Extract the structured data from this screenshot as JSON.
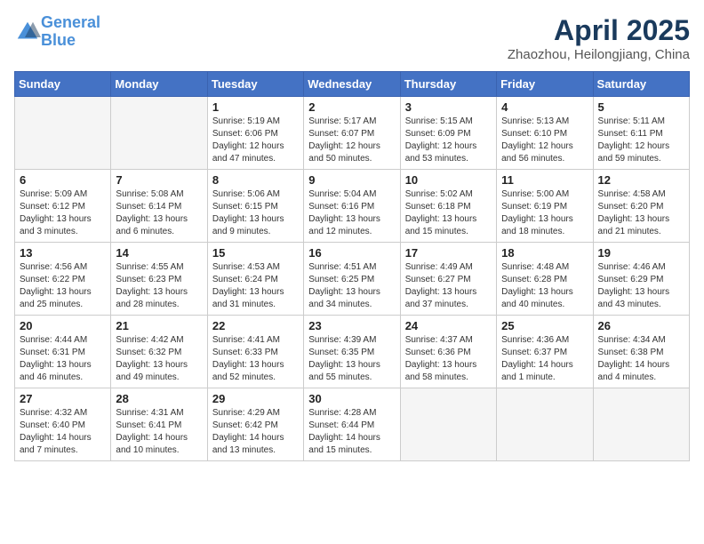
{
  "header": {
    "logo_line1": "General",
    "logo_line2": "Blue",
    "month": "April 2025",
    "location": "Zhaozhou, Heilongjiang, China"
  },
  "weekdays": [
    "Sunday",
    "Monday",
    "Tuesday",
    "Wednesday",
    "Thursday",
    "Friday",
    "Saturday"
  ],
  "weeks": [
    [
      {
        "day": "",
        "info": ""
      },
      {
        "day": "",
        "info": ""
      },
      {
        "day": "1",
        "info": "Sunrise: 5:19 AM\nSunset: 6:06 PM\nDaylight: 12 hours\nand 47 minutes."
      },
      {
        "day": "2",
        "info": "Sunrise: 5:17 AM\nSunset: 6:07 PM\nDaylight: 12 hours\nand 50 minutes."
      },
      {
        "day": "3",
        "info": "Sunrise: 5:15 AM\nSunset: 6:09 PM\nDaylight: 12 hours\nand 53 minutes."
      },
      {
        "day": "4",
        "info": "Sunrise: 5:13 AM\nSunset: 6:10 PM\nDaylight: 12 hours\nand 56 minutes."
      },
      {
        "day": "5",
        "info": "Sunrise: 5:11 AM\nSunset: 6:11 PM\nDaylight: 12 hours\nand 59 minutes."
      }
    ],
    [
      {
        "day": "6",
        "info": "Sunrise: 5:09 AM\nSunset: 6:12 PM\nDaylight: 13 hours\nand 3 minutes."
      },
      {
        "day": "7",
        "info": "Sunrise: 5:08 AM\nSunset: 6:14 PM\nDaylight: 13 hours\nand 6 minutes."
      },
      {
        "day": "8",
        "info": "Sunrise: 5:06 AM\nSunset: 6:15 PM\nDaylight: 13 hours\nand 9 minutes."
      },
      {
        "day": "9",
        "info": "Sunrise: 5:04 AM\nSunset: 6:16 PM\nDaylight: 13 hours\nand 12 minutes."
      },
      {
        "day": "10",
        "info": "Sunrise: 5:02 AM\nSunset: 6:18 PM\nDaylight: 13 hours\nand 15 minutes."
      },
      {
        "day": "11",
        "info": "Sunrise: 5:00 AM\nSunset: 6:19 PM\nDaylight: 13 hours\nand 18 minutes."
      },
      {
        "day": "12",
        "info": "Sunrise: 4:58 AM\nSunset: 6:20 PM\nDaylight: 13 hours\nand 21 minutes."
      }
    ],
    [
      {
        "day": "13",
        "info": "Sunrise: 4:56 AM\nSunset: 6:22 PM\nDaylight: 13 hours\nand 25 minutes."
      },
      {
        "day": "14",
        "info": "Sunrise: 4:55 AM\nSunset: 6:23 PM\nDaylight: 13 hours\nand 28 minutes."
      },
      {
        "day": "15",
        "info": "Sunrise: 4:53 AM\nSunset: 6:24 PM\nDaylight: 13 hours\nand 31 minutes."
      },
      {
        "day": "16",
        "info": "Sunrise: 4:51 AM\nSunset: 6:25 PM\nDaylight: 13 hours\nand 34 minutes."
      },
      {
        "day": "17",
        "info": "Sunrise: 4:49 AM\nSunset: 6:27 PM\nDaylight: 13 hours\nand 37 minutes."
      },
      {
        "day": "18",
        "info": "Sunrise: 4:48 AM\nSunset: 6:28 PM\nDaylight: 13 hours\nand 40 minutes."
      },
      {
        "day": "19",
        "info": "Sunrise: 4:46 AM\nSunset: 6:29 PM\nDaylight: 13 hours\nand 43 minutes."
      }
    ],
    [
      {
        "day": "20",
        "info": "Sunrise: 4:44 AM\nSunset: 6:31 PM\nDaylight: 13 hours\nand 46 minutes."
      },
      {
        "day": "21",
        "info": "Sunrise: 4:42 AM\nSunset: 6:32 PM\nDaylight: 13 hours\nand 49 minutes."
      },
      {
        "day": "22",
        "info": "Sunrise: 4:41 AM\nSunset: 6:33 PM\nDaylight: 13 hours\nand 52 minutes."
      },
      {
        "day": "23",
        "info": "Sunrise: 4:39 AM\nSunset: 6:35 PM\nDaylight: 13 hours\nand 55 minutes."
      },
      {
        "day": "24",
        "info": "Sunrise: 4:37 AM\nSunset: 6:36 PM\nDaylight: 13 hours\nand 58 minutes."
      },
      {
        "day": "25",
        "info": "Sunrise: 4:36 AM\nSunset: 6:37 PM\nDaylight: 14 hours\nand 1 minute."
      },
      {
        "day": "26",
        "info": "Sunrise: 4:34 AM\nSunset: 6:38 PM\nDaylight: 14 hours\nand 4 minutes."
      }
    ],
    [
      {
        "day": "27",
        "info": "Sunrise: 4:32 AM\nSunset: 6:40 PM\nDaylight: 14 hours\nand 7 minutes."
      },
      {
        "day": "28",
        "info": "Sunrise: 4:31 AM\nSunset: 6:41 PM\nDaylight: 14 hours\nand 10 minutes."
      },
      {
        "day": "29",
        "info": "Sunrise: 4:29 AM\nSunset: 6:42 PM\nDaylight: 14 hours\nand 13 minutes."
      },
      {
        "day": "30",
        "info": "Sunrise: 4:28 AM\nSunset: 6:44 PM\nDaylight: 14 hours\nand 15 minutes."
      },
      {
        "day": "",
        "info": ""
      },
      {
        "day": "",
        "info": ""
      },
      {
        "day": "",
        "info": ""
      }
    ]
  ]
}
